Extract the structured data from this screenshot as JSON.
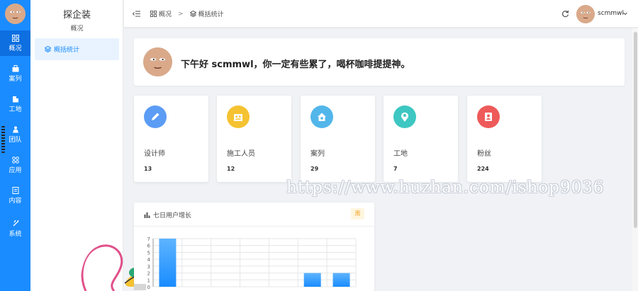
{
  "rail": {
    "items": [
      {
        "label": "概况",
        "icon": "dashboard-icon"
      },
      {
        "label": "案列",
        "icon": "case-icon"
      },
      {
        "label": "工地",
        "icon": "site-icon"
      },
      {
        "label": "团队",
        "icon": "team-icon"
      },
      {
        "label": "应用",
        "icon": "apps-icon"
      },
      {
        "label": "内容",
        "icon": "content-icon"
      },
      {
        "label": "系统",
        "icon": "system-icon"
      }
    ]
  },
  "sidebar": {
    "brand": "探企装",
    "subtitle": "概况",
    "items": [
      {
        "label": "概括统计",
        "icon": "layers-icon"
      }
    ]
  },
  "header": {
    "breadcrumb": [
      {
        "label": "概况",
        "icon": "dashboard-icon"
      },
      {
        "label": "概括统计",
        "icon": "layers-icon"
      }
    ],
    "separator": ">",
    "username": "scmmwl"
  },
  "greeting": "下午好 scmmwl，你一定有些累了，喝杯咖啡提提神。",
  "stats": [
    {
      "label": "设计师",
      "value": "13",
      "icon": "pencil-icon",
      "color": "#5b9cf5"
    },
    {
      "label": "施工人员",
      "value": "12",
      "icon": "building-icon",
      "color": "#f5c232"
    },
    {
      "label": "案列",
      "value": "29",
      "icon": "home-icon",
      "color": "#52b6ea"
    },
    {
      "label": "工地",
      "value": "7",
      "icon": "location-user-icon",
      "color": "#3ec7c2"
    },
    {
      "label": "粉丝",
      "value": "224",
      "icon": "user-card-icon",
      "color": "#ee5a5a"
    }
  ],
  "chart_card": {
    "title": "七日用户增长",
    "tag": "周"
  },
  "chart_data": {
    "type": "bar",
    "title": "七日用户增长",
    "categories": [
      "",
      "",
      "",
      "",
      "",
      "",
      ""
    ],
    "values": [
      7,
      0,
      0,
      0,
      0,
      2,
      2
    ],
    "ylim": [
      0,
      7
    ],
    "yticks": [
      "0",
      "1",
      "2",
      "3",
      "4",
      "5",
      "6",
      "7"
    ],
    "grid": true,
    "color": "#1a8cff"
  },
  "watermark": "https://www.huzhan.com/ishop9036",
  "colors": {
    "accent": "#1a8cff",
    "rail": "#1a8cff"
  }
}
